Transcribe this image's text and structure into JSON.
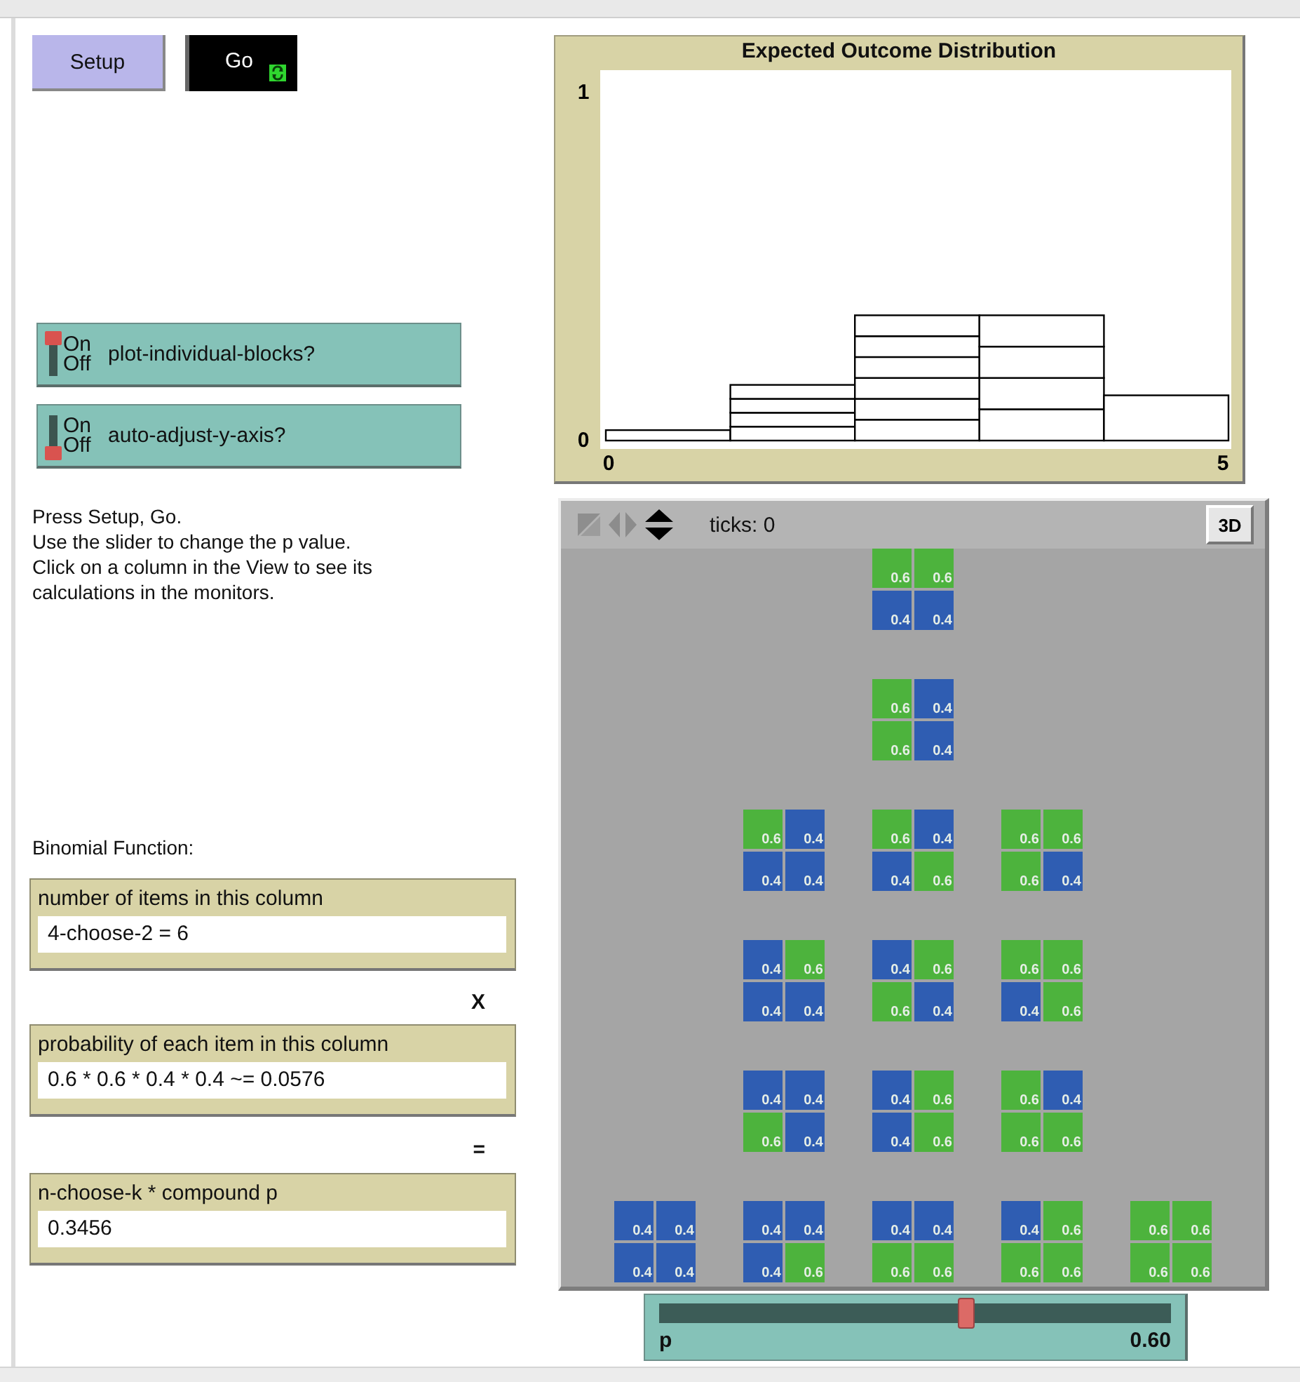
{
  "buttons": [
    {
      "label": "Setup",
      "kind": "once"
    },
    {
      "label": "Go",
      "kind": "forever"
    }
  ],
  "switches": [
    {
      "label": "plot-individual-blocks?",
      "on_text": "On",
      "off_text": "Off",
      "on": true
    },
    {
      "label": "auto-adjust-y-axis?",
      "on_text": "On",
      "off_text": "Off",
      "on": false
    }
  ],
  "note": "Press Setup, Go.\nUse the slider to change the p value.\nClick on a column in the View to see its\ncalculations in the monitors.",
  "section_label": "Binomial Function:",
  "calculation": [
    {
      "kind": "monitor",
      "label": "number of items in this column",
      "value": "4-choose-2 = 6"
    },
    {
      "kind": "operator",
      "text": "X"
    },
    {
      "kind": "monitor",
      "label": "probability of each item in this column",
      "value": "0.6 * 0.6 * 0.4 * 0.4 ~= 0.0576"
    },
    {
      "kind": "operator",
      "text": "="
    },
    {
      "kind": "monitor",
      "label": "n-choose-k * compound p",
      "value": "0.3456"
    }
  ],
  "plot": {
    "chart_data": {
      "type": "bar",
      "title": "Expected Outcome Distribution",
      "x": [
        0.5,
        1.5,
        2.5,
        3.5,
        4.5
      ],
      "xlim": [
        0,
        5
      ],
      "ylim": [
        0,
        1
      ],
      "xticks": [
        0,
        5
      ],
      "yticks": [
        0,
        1
      ],
      "stacked": true,
      "series": [
        {
          "color": "#ffffff",
          "values": [
            0.03,
            0.04,
            0.06,
            0.09,
            0.13
          ]
        },
        {
          "color": "#ffffff",
          "values": [
            null,
            0.04,
            0.06,
            0.09,
            null
          ]
        },
        {
          "color": "#ffffff",
          "values": [
            null,
            0.04,
            0.06,
            0.09,
            null
          ]
        },
        {
          "color": "#ffffff",
          "values": [
            null,
            0.04,
            0.06,
            0.09,
            null
          ]
        },
        {
          "color": "#ffffff",
          "values": [
            null,
            null,
            0.06,
            null,
            null
          ]
        },
        {
          "color": "#ffffff",
          "values": [
            null,
            null,
            0.06,
            null,
            null
          ]
        }
      ]
    }
  },
  "view": {
    "ticks": "ticks: 0",
    "button": "3D",
    "columns": [
      {
        "blocks": [
          {
            "cells": [
              {
                "text": "0.4",
                "color": "#2f5db2"
              },
              {
                "text": "0.4",
                "color": "#2f5db2"
              },
              {
                "text": "0.4",
                "color": "#2f5db2"
              },
              {
                "text": "0.4",
                "color": "#2f5db2"
              }
            ]
          }
        ]
      },
      {
        "blocks": [
          {
            "cells": [
              {
                "text": "0.6",
                "color": "#4db33d"
              },
              {
                "text": "0.4",
                "color": "#2f5db2"
              },
              {
                "text": "0.4",
                "color": "#2f5db2"
              },
              {
                "text": "0.4",
                "color": "#2f5db2"
              }
            ]
          },
          {
            "cells": [
              {
                "text": "0.4",
                "color": "#2f5db2"
              },
              {
                "text": "0.6",
                "color": "#4db33d"
              },
              {
                "text": "0.4",
                "color": "#2f5db2"
              },
              {
                "text": "0.4",
                "color": "#2f5db2"
              }
            ]
          },
          {
            "cells": [
              {
                "text": "0.4",
                "color": "#2f5db2"
              },
              {
                "text": "0.4",
                "color": "#2f5db2"
              },
              {
                "text": "0.6",
                "color": "#4db33d"
              },
              {
                "text": "0.4",
                "color": "#2f5db2"
              }
            ]
          },
          {
            "cells": [
              {
                "text": "0.4",
                "color": "#2f5db2"
              },
              {
                "text": "0.4",
                "color": "#2f5db2"
              },
              {
                "text": "0.4",
                "color": "#2f5db2"
              },
              {
                "text": "0.6",
                "color": "#4db33d"
              }
            ]
          }
        ]
      },
      {
        "blocks": [
          {
            "cells": [
              {
                "text": "0.6",
                "color": "#4db33d"
              },
              {
                "text": "0.6",
                "color": "#4db33d"
              },
              {
                "text": "0.4",
                "color": "#2f5db2"
              },
              {
                "text": "0.4",
                "color": "#2f5db2"
              }
            ]
          },
          {
            "cells": [
              {
                "text": "0.6",
                "color": "#4db33d"
              },
              {
                "text": "0.4",
                "color": "#2f5db2"
              },
              {
                "text": "0.6",
                "color": "#4db33d"
              },
              {
                "text": "0.4",
                "color": "#2f5db2"
              }
            ]
          },
          {
            "cells": [
              {
                "text": "0.6",
                "color": "#4db33d"
              },
              {
                "text": "0.4",
                "color": "#2f5db2"
              },
              {
                "text": "0.4",
                "color": "#2f5db2"
              },
              {
                "text": "0.6",
                "color": "#4db33d"
              }
            ]
          },
          {
            "cells": [
              {
                "text": "0.4",
                "color": "#2f5db2"
              },
              {
                "text": "0.6",
                "color": "#4db33d"
              },
              {
                "text": "0.6",
                "color": "#4db33d"
              },
              {
                "text": "0.4",
                "color": "#2f5db2"
              }
            ]
          },
          {
            "cells": [
              {
                "text": "0.4",
                "color": "#2f5db2"
              },
              {
                "text": "0.6",
                "color": "#4db33d"
              },
              {
                "text": "0.4",
                "color": "#2f5db2"
              },
              {
                "text": "0.6",
                "color": "#4db33d"
              }
            ]
          },
          {
            "cells": [
              {
                "text": "0.4",
                "color": "#2f5db2"
              },
              {
                "text": "0.4",
                "color": "#2f5db2"
              },
              {
                "text": "0.6",
                "color": "#4db33d"
              },
              {
                "text": "0.6",
                "color": "#4db33d"
              }
            ]
          }
        ]
      },
      {
        "blocks": [
          {
            "cells": [
              {
                "text": "0.6",
                "color": "#4db33d"
              },
              {
                "text": "0.6",
                "color": "#4db33d"
              },
              {
                "text": "0.6",
                "color": "#4db33d"
              },
              {
                "text": "0.4",
                "color": "#2f5db2"
              }
            ]
          },
          {
            "cells": [
              {
                "text": "0.6",
                "color": "#4db33d"
              },
              {
                "text": "0.6",
                "color": "#4db33d"
              },
              {
                "text": "0.4",
                "color": "#2f5db2"
              },
              {
                "text": "0.6",
                "color": "#4db33d"
              }
            ]
          },
          {
            "cells": [
              {
                "text": "0.6",
                "color": "#4db33d"
              },
              {
                "text": "0.4",
                "color": "#2f5db2"
              },
              {
                "text": "0.6",
                "color": "#4db33d"
              },
              {
                "text": "0.6",
                "color": "#4db33d"
              }
            ]
          },
          {
            "cells": [
              {
                "text": "0.4",
                "color": "#2f5db2"
              },
              {
                "text": "0.6",
                "color": "#4db33d"
              },
              {
                "text": "0.6",
                "color": "#4db33d"
              },
              {
                "text": "0.6",
                "color": "#4db33d"
              }
            ]
          }
        ]
      },
      {
        "blocks": [
          {
            "cells": [
              {
                "text": "0.6",
                "color": "#4db33d"
              },
              {
                "text": "0.6",
                "color": "#4db33d"
              },
              {
                "text": "0.6",
                "color": "#4db33d"
              },
              {
                "text": "0.6",
                "color": "#4db33d"
              }
            ]
          }
        ]
      }
    ]
  },
  "slider": {
    "label": "p",
    "value": "0.60",
    "level": 0.6
  }
}
